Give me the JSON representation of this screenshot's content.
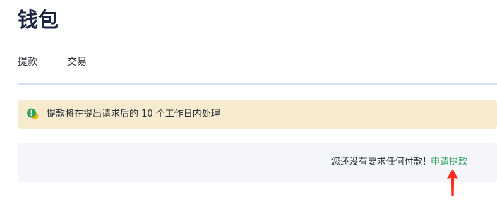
{
  "page": {
    "title": "钱包"
  },
  "tabs": [
    {
      "label": "提款",
      "active": true
    },
    {
      "label": "交易",
      "active": false
    }
  ],
  "notice": {
    "icon": "alert-badge-icon",
    "text": "提款将在提出请求后的 10 个工作日内处理"
  },
  "withdrawals": {
    "empty_text": "您还没有要求任何付款!",
    "request_link": "申请提款"
  },
  "colors": {
    "accent": "#22a055",
    "link": "#3aa268",
    "notice_bg": "#f7ebcf",
    "panel_bg": "#f4f6f9",
    "annotation_arrow": "#ff2a1a"
  }
}
